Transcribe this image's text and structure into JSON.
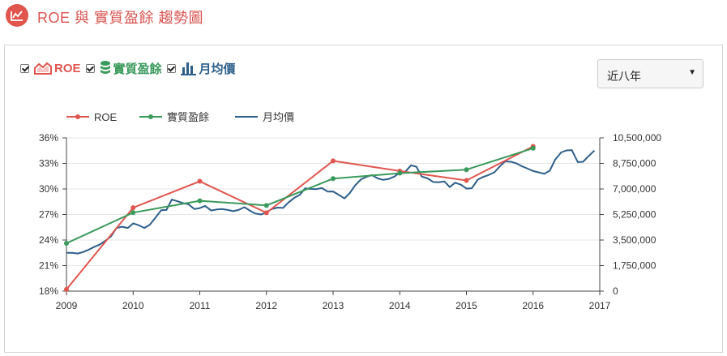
{
  "header": {
    "title": "ROE 與 實質盈餘 趨勢圖",
    "icon": "trend-chart-icon"
  },
  "toggles": [
    {
      "label": "ROE",
      "checked": true,
      "icon": "roe-area-icon",
      "color": "#e0564f"
    },
    {
      "label": "實質盈餘",
      "checked": true,
      "icon": "coin-stack-icon",
      "color": "#3a9a5c"
    },
    {
      "label": "月均價",
      "checked": true,
      "icon": "bar-chart-icon",
      "color": "#2d5f8a"
    }
  ],
  "range_select": {
    "selected": "近八年"
  },
  "chart_data": {
    "type": "line",
    "legend": [
      "ROE",
      "實質盈餘",
      "月均價"
    ],
    "x_ticks": [
      "2009",
      "2010",
      "2011",
      "2012",
      "2013",
      "2014",
      "2015",
      "2016",
      "2017"
    ],
    "y_left_ticks": [
      "36%",
      "33%",
      "30%",
      "27%",
      "24%",
      "21%",
      "18%"
    ],
    "y_right_ticks": [
      "10,500,000",
      "8,750,000",
      "7,000,000",
      "5,250,000",
      "3,500,000",
      "1,750,000",
      "0"
    ],
    "y_left_range": [
      18,
      36
    ],
    "y_right_range": [
      0,
      10500000
    ],
    "x_range": [
      2009,
      2017
    ],
    "series": [
      {
        "name": "ROE",
        "color": "#e0564f",
        "axis": "left",
        "markers": true,
        "points": [
          [
            2009,
            18.2
          ],
          [
            2010,
            27.8
          ],
          [
            2011,
            30.9
          ],
          [
            2012,
            27.2
          ],
          [
            2013,
            33.3
          ],
          [
            2014,
            32.1
          ],
          [
            2015,
            31.0
          ],
          [
            2016,
            35.0
          ]
        ]
      },
      {
        "name": "實質盈餘",
        "color": "#3a9a5c",
        "axis": "right",
        "markers": true,
        "points": [
          [
            2009,
            3280000
          ],
          [
            2010,
            5380000
          ],
          [
            2011,
            6190000
          ],
          [
            2012,
            5870000
          ],
          [
            2013,
            7710000
          ],
          [
            2014,
            8080000
          ],
          [
            2015,
            8320000
          ],
          [
            2016,
            9790000
          ]
        ]
      },
      {
        "name": "月均價",
        "color": "#2d5f8a",
        "axis": "right",
        "markers": false,
        "points": [
          [
            2009.0,
            2630000
          ],
          [
            2009.08,
            2630000
          ],
          [
            2009.17,
            2580000
          ],
          [
            2009.25,
            2680000
          ],
          [
            2009.33,
            2830000
          ],
          [
            2009.42,
            3040000
          ],
          [
            2009.5,
            3190000
          ],
          [
            2009.58,
            3440000
          ],
          [
            2009.67,
            3760000
          ],
          [
            2009.75,
            4320000
          ],
          [
            2009.83,
            4410000
          ],
          [
            2009.92,
            4330000
          ],
          [
            2010.0,
            4640000
          ],
          [
            2010.08,
            4520000
          ],
          [
            2010.17,
            4330000
          ],
          [
            2010.25,
            4550000
          ],
          [
            2010.33,
            5000000
          ],
          [
            2010.42,
            5540000
          ],
          [
            2010.5,
            5560000
          ],
          [
            2010.58,
            6270000
          ],
          [
            2010.67,
            6150000
          ],
          [
            2010.75,
            6030000
          ],
          [
            2010.83,
            5950000
          ],
          [
            2010.92,
            5620000
          ],
          [
            2011.0,
            5690000
          ],
          [
            2011.08,
            5840000
          ],
          [
            2011.17,
            5520000
          ],
          [
            2011.25,
            5590000
          ],
          [
            2011.33,
            5620000
          ],
          [
            2011.42,
            5560000
          ],
          [
            2011.5,
            5480000
          ],
          [
            2011.58,
            5560000
          ],
          [
            2011.67,
            5750000
          ],
          [
            2011.75,
            5520000
          ],
          [
            2011.83,
            5320000
          ],
          [
            2011.92,
            5250000
          ],
          [
            2012.0,
            5400000
          ],
          [
            2012.08,
            5620000
          ],
          [
            2012.17,
            5720000
          ],
          [
            2012.25,
            5700000
          ],
          [
            2012.33,
            6070000
          ],
          [
            2012.42,
            6400000
          ],
          [
            2012.5,
            6600000
          ],
          [
            2012.58,
            7040000
          ],
          [
            2012.67,
            7000000
          ],
          [
            2012.75,
            6990000
          ],
          [
            2012.83,
            7060000
          ],
          [
            2012.92,
            6820000
          ],
          [
            2013.0,
            6830000
          ],
          [
            2013.08,
            6610000
          ],
          [
            2013.17,
            6350000
          ],
          [
            2013.25,
            6720000
          ],
          [
            2013.33,
            7240000
          ],
          [
            2013.42,
            7660000
          ],
          [
            2013.5,
            7830000
          ],
          [
            2013.58,
            7950000
          ],
          [
            2013.67,
            7720000
          ],
          [
            2013.75,
            7620000
          ],
          [
            2013.83,
            7680000
          ],
          [
            2013.92,
            7850000
          ],
          [
            2014.0,
            8120000
          ],
          [
            2014.08,
            8160000
          ],
          [
            2014.17,
            8620000
          ],
          [
            2014.25,
            8520000
          ],
          [
            2014.33,
            7850000
          ],
          [
            2014.42,
            7720000
          ],
          [
            2014.5,
            7480000
          ],
          [
            2014.58,
            7460000
          ],
          [
            2014.67,
            7510000
          ],
          [
            2014.75,
            7130000
          ],
          [
            2014.83,
            7430000
          ],
          [
            2014.92,
            7290000
          ],
          [
            2015.0,
            7020000
          ],
          [
            2015.08,
            7050000
          ],
          [
            2015.17,
            7640000
          ],
          [
            2015.25,
            7820000
          ],
          [
            2015.33,
            7950000
          ],
          [
            2015.42,
            8140000
          ],
          [
            2015.5,
            8540000
          ],
          [
            2015.58,
            8890000
          ],
          [
            2015.67,
            8860000
          ],
          [
            2015.75,
            8750000
          ],
          [
            2015.83,
            8560000
          ],
          [
            2015.92,
            8390000
          ],
          [
            2016.0,
            8230000
          ],
          [
            2016.08,
            8140000
          ],
          [
            2016.17,
            8040000
          ],
          [
            2016.25,
            8250000
          ],
          [
            2016.33,
            9000000
          ],
          [
            2016.42,
            9500000
          ],
          [
            2016.5,
            9640000
          ],
          [
            2016.58,
            9660000
          ],
          [
            2016.67,
            8840000
          ],
          [
            2016.75,
            8860000
          ],
          [
            2016.83,
            9240000
          ],
          [
            2016.92,
            9630000
          ]
        ]
      }
    ]
  }
}
